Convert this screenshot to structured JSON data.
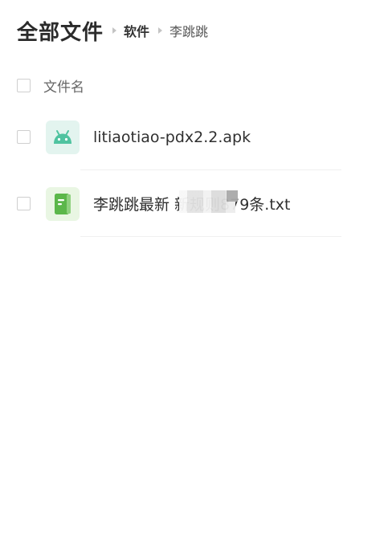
{
  "breadcrumb": {
    "root": "全部文件",
    "middle": "软件",
    "current": "李跳跳"
  },
  "list_header": {
    "name_label": "文件名"
  },
  "files": [
    {
      "name": "litiaotiao-pdx2.2.apk",
      "icon": "android-icon",
      "icon_color": "#4fc3a0"
    },
    {
      "name": "李跳跳最新                   新规则879条.txt",
      "icon": "text-document-icon",
      "icon_color": "#5bb74a"
    }
  ],
  "colors": {
    "background": "#ffffff",
    "text_primary": "#2f2f2f",
    "text_secondary": "#666666",
    "divider": "#f0f0f0"
  }
}
